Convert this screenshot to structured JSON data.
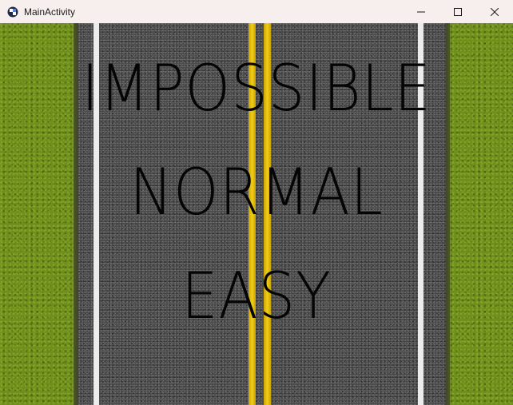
{
  "window": {
    "title": "MainActivity",
    "icon": "app-icon",
    "controls": {
      "minimize_icon": "minimize-icon",
      "maximize_icon": "maximize-icon",
      "close_icon": "close-icon"
    }
  },
  "menu": {
    "items": [
      {
        "label": "IMPOSSIBLE"
      },
      {
        "label": "NORMAL"
      },
      {
        "label": "EASY"
      }
    ]
  },
  "colors": {
    "grass": "#6f8f1c",
    "asphalt": "#4a4a4a",
    "lane_white": "#ececec",
    "lane_yellow": "#f2cd1a",
    "text": "#050505"
  }
}
